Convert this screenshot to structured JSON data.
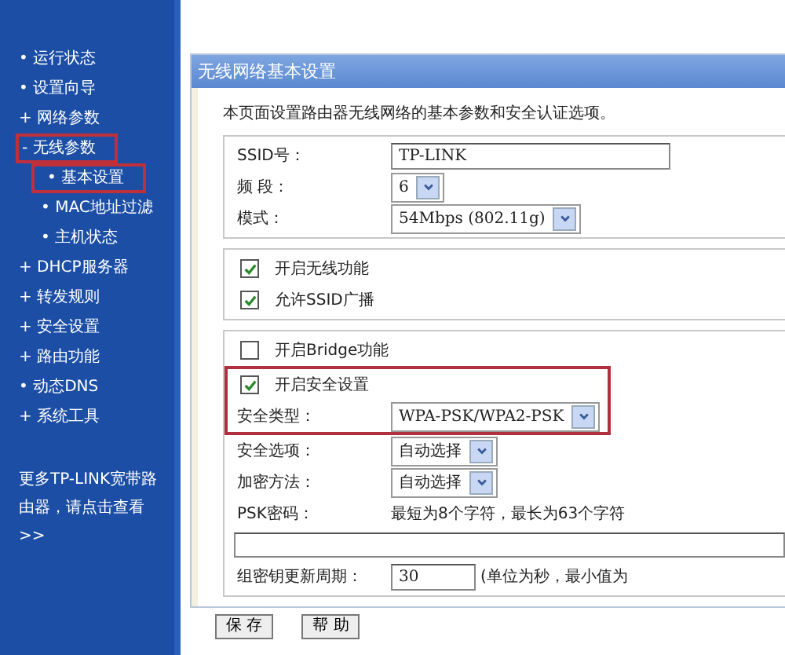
{
  "sidebar": {
    "items": [
      {
        "marker": "•",
        "label": "运行状态",
        "highlighted": false
      },
      {
        "marker": "•",
        "label": "设置向导",
        "highlighted": false
      },
      {
        "marker": "+",
        "label": "网络参数",
        "highlighted": false
      },
      {
        "marker": "-",
        "label": "无线参数",
        "highlighted": true,
        "children": [
          {
            "marker": "•",
            "label": "基本设置",
            "highlighted": true
          },
          {
            "marker": "•",
            "label": "MAC地址过滤",
            "highlighted": false
          },
          {
            "marker": "•",
            "label": "主机状态",
            "highlighted": false
          }
        ]
      },
      {
        "marker": "+",
        "label": "DHCP服务器",
        "highlighted": false
      },
      {
        "marker": "+",
        "label": "转发规则",
        "highlighted": false
      },
      {
        "marker": "+",
        "label": "安全设置",
        "highlighted": false
      },
      {
        "marker": "+",
        "label": "路由功能",
        "highlighted": false
      },
      {
        "marker": "•",
        "label": "动态DNS",
        "highlighted": false
      },
      {
        "marker": "+",
        "label": "系统工具",
        "highlighted": false
      }
    ],
    "footer": "更多TP-LINK宽带路由器，请点击查看 >>"
  },
  "panel": {
    "title": "无线网络基本设置",
    "description": "本页面设置路由器无线网络的基本参数和安全认证选项。",
    "groups": [
      {
        "rows": [
          {
            "kind": "text",
            "label": "SSID号：",
            "value": "TP-LINK"
          },
          {
            "kind": "select",
            "label": "频 段：",
            "value": "6"
          },
          {
            "kind": "select",
            "label": "模式：",
            "value": "54Mbps (802.11g)"
          }
        ]
      },
      {
        "rows": [
          {
            "kind": "checkbox",
            "label": "开启无线功能",
            "checked": true
          },
          {
            "kind": "checkbox",
            "label": "允许SSID广播",
            "checked": true
          }
        ]
      },
      {
        "rows": [
          {
            "kind": "checkbox",
            "label": "开启Bridge功能",
            "checked": false
          },
          {
            "kind": "checkbox",
            "label": "开启安全设置",
            "checked": true,
            "highlighted": true
          },
          {
            "kind": "select",
            "label": "安全类型：",
            "value": "WPA-PSK/WPA2-PSK",
            "highlighted": true
          },
          {
            "kind": "select",
            "label": "安全选项：",
            "value": "自动选择"
          },
          {
            "kind": "select",
            "label": "加密方法：",
            "value": "自动选择"
          },
          {
            "kind": "note",
            "label": "PSK密码：",
            "value": "最短为8个字符，最长为63个字符"
          },
          {
            "kind": "wide-input"
          },
          {
            "kind": "short-input",
            "label": "组密钥更新周期：",
            "value": "30",
            "note": "(单位为秒，最小值为"
          }
        ]
      }
    ],
    "buttons": [
      "保 存",
      "帮 助"
    ]
  }
}
